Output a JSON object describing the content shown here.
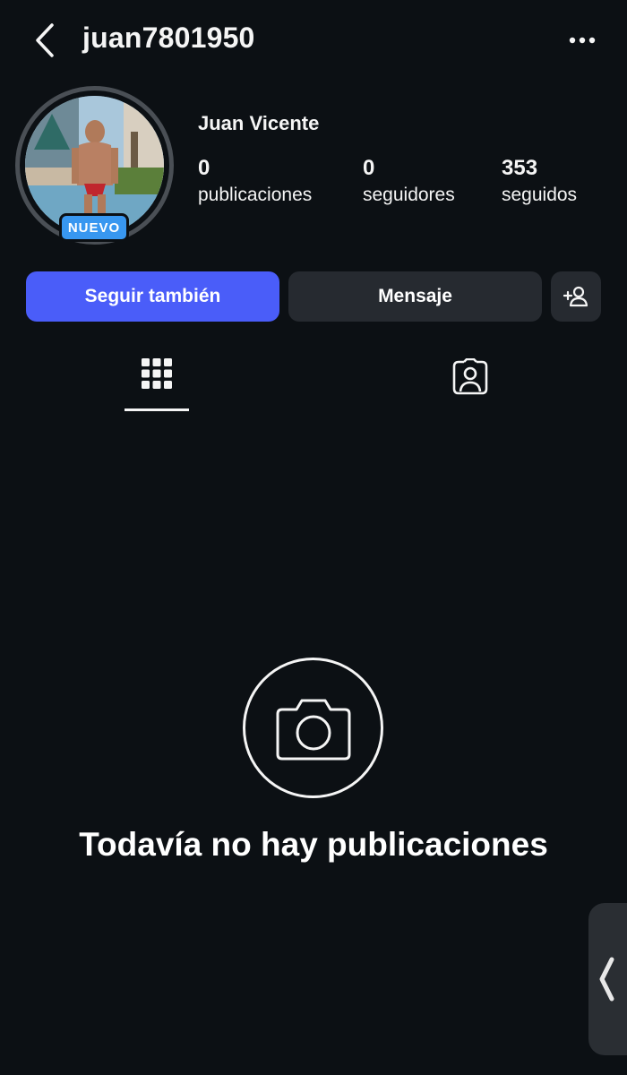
{
  "header": {
    "username": "juan7801950",
    "back_icon": "chevron-left-icon",
    "more_icon": "more-horizontal-icon"
  },
  "profile": {
    "display_name": "Juan Vicente",
    "badge": "NUEVO",
    "stats": [
      {
        "value": "0",
        "label": "publicaciones"
      },
      {
        "value": "0",
        "label": "seguidores"
      },
      {
        "value": "353",
        "label": "seguidos"
      }
    ]
  },
  "actions": {
    "follow_label": "Seguir también",
    "message_label": "Mensaje",
    "add_user_icon": "add-user-icon"
  },
  "tabs": [
    {
      "name": "posts-grid",
      "icon": "grid-icon",
      "active": true
    },
    {
      "name": "tagged",
      "icon": "tagged-person-icon",
      "active": false
    }
  ],
  "empty_state": {
    "icon": "camera-icon",
    "text": "Todavía no hay publicaciones"
  },
  "colors": {
    "background": "#0c1014",
    "primary_button": "#4a5df9",
    "secondary_button": "#262a30",
    "badge": "#3897f0"
  }
}
